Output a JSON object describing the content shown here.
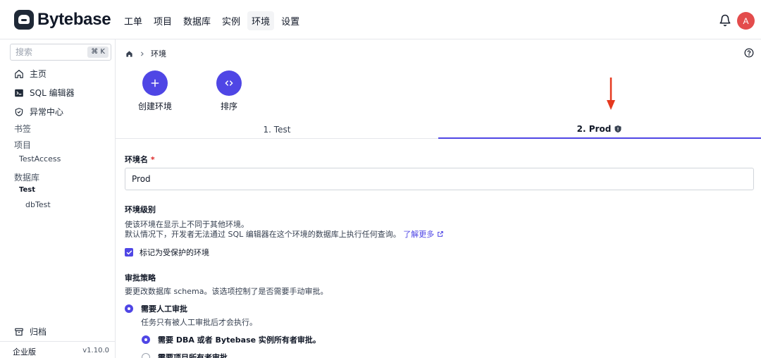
{
  "header": {
    "logo_text": "Bytebase",
    "nav": [
      "工单",
      "项目",
      "数据库",
      "实例",
      "环境",
      "设置"
    ],
    "active_nav": "环境",
    "avatar_initial": "A"
  },
  "sidebar": {
    "search_placeholder": "搜索",
    "search_shortcut": "⌘ K",
    "items": [
      "主页",
      "SQL 编辑器",
      "异常中心"
    ],
    "groups": [
      "书签",
      "项目",
      "数据库"
    ],
    "project_items": [
      "TestAccess"
    ],
    "database_env": "Test",
    "database_items": [
      "dbTest"
    ],
    "archive": "归档",
    "edition": "企业版",
    "version": "v1.10.0"
  },
  "main": {
    "breadcrumb": "环境",
    "actions": {
      "create": "创建环境",
      "reorder": "排序"
    },
    "tabs": [
      "1. Test",
      "2. Prod"
    ],
    "active_tab": "2. Prod",
    "env_name_label": "环境名",
    "env_name_required": "*",
    "env_name_value": "Prod",
    "tier_label": "环境级别",
    "tier_desc1": "使该环境在显示上不同于其他环境。",
    "tier_desc2": "默认情况下，开发者无法通过 SQL 编辑器在这个环境的数据库上执行任何查询。",
    "learn_more": "了解更多",
    "protected_label": "标记为受保护的环境",
    "protected_checked": true,
    "approval_label": "审批策略",
    "approval_desc": "要更改数据库 schema。该选项控制了是否需要手动审批。",
    "manual_approval": "需要人工审批",
    "manual_approval_desc": "任务只有被人工审批后才会执行。",
    "option_dba": "需要 DBA 或者 Bytebase 实例所有者审批。",
    "option_project_owner": "需要项目所有者审批。"
  },
  "colors": {
    "accent": "#4f46e5",
    "arrow": "#e5391f",
    "avatar": "#e34c4c"
  }
}
